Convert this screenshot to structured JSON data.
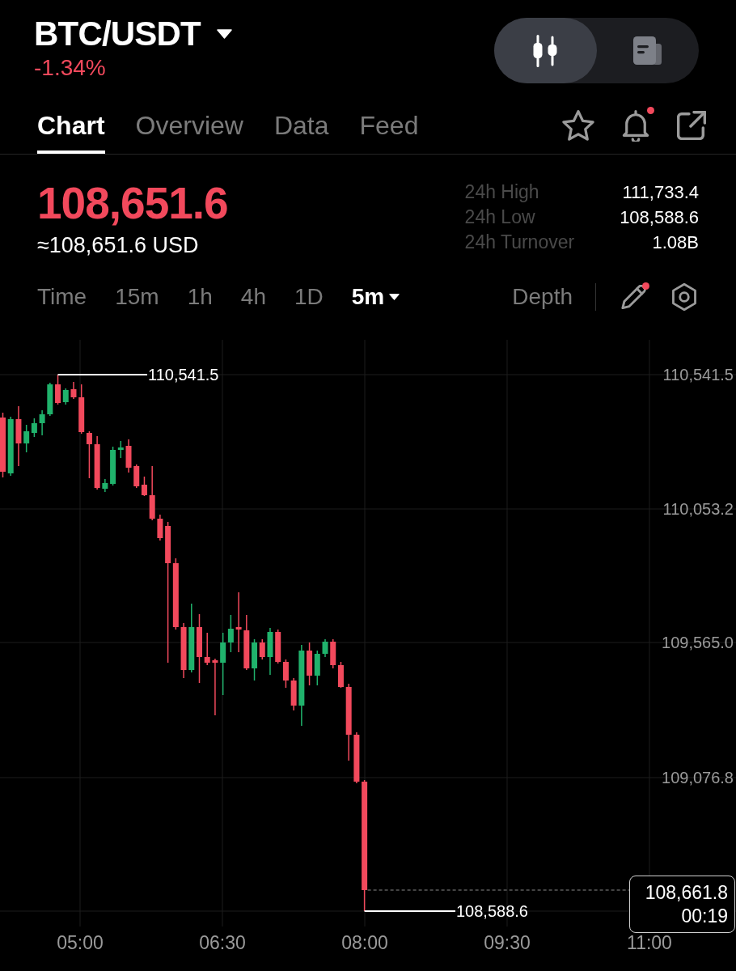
{
  "header": {
    "pair": "BTC/USDT",
    "change": "-1.34%",
    "falling": true,
    "view_toggle": [
      {
        "kind": "candles",
        "selected": true
      },
      {
        "kind": "document",
        "selected": false
      }
    ]
  },
  "tabs": [
    {
      "label": "Chart",
      "selected": true
    },
    {
      "label": "Overview",
      "selected": false
    },
    {
      "label": "Data",
      "selected": false
    },
    {
      "label": "Feed",
      "selected": false
    }
  ],
  "tab_actions": [
    {
      "kind": "star",
      "badge": false
    },
    {
      "kind": "bell",
      "badge": true
    },
    {
      "kind": "share",
      "badge": false
    }
  ],
  "price": {
    "last": "108,651.6",
    "converted": "≈108,651.6 USD",
    "stats": [
      {
        "label": "24h High",
        "value": "111,733.4"
      },
      {
        "label": "24h Low",
        "value": "108,588.6"
      },
      {
        "label": "24h Turnover",
        "value": "1.08B"
      }
    ]
  },
  "intervals": [
    {
      "label": "Time",
      "selected": false,
      "dropdown": false
    },
    {
      "label": "15m",
      "selected": false,
      "dropdown": false
    },
    {
      "label": "1h",
      "selected": false,
      "dropdown": false
    },
    {
      "label": "4h",
      "selected": false,
      "dropdown": false
    },
    {
      "label": "1D",
      "selected": false,
      "dropdown": false
    },
    {
      "label": "5m",
      "selected": true,
      "dropdown": true
    }
  ],
  "depth_button": "Depth",
  "chart_tools": [
    {
      "kind": "pencil",
      "badge": true
    },
    {
      "kind": "settings",
      "badge": false
    }
  ],
  "chart": {
    "price_axis": [
      "110,541.5",
      "110,053.2",
      "109,565.0",
      "109,076.8"
    ],
    "time_axis": [
      "05:00",
      "06:30",
      "08:00",
      "09:30",
      "11:00"
    ],
    "high_label": "110,541.5",
    "low_label": "108,588.6",
    "last_price": "108,661.8",
    "countdown": "00:19"
  }
}
